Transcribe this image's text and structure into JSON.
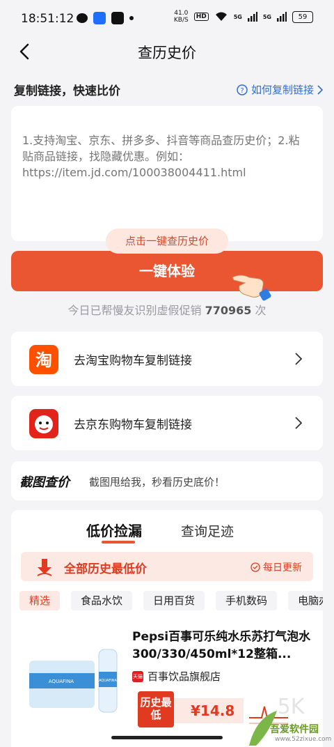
{
  "status_bar": {
    "time": "18:51:12",
    "net_speed": "41.0",
    "net_unit": "KB/S",
    "hd": "HD",
    "battery": "59",
    "signal1": "5G",
    "signal2": "5G"
  },
  "nav": {
    "title": "查历史价"
  },
  "copy_section": {
    "heading": "复制链接，快速比价",
    "howto": "如何复制链接"
  },
  "paste_box": {
    "placeholder": "1.支持淘宝、京东、拼多多、抖音等商品查历史价；2.粘贴商品链接，找隐藏优惠。例如：https://item.jd.com/100038004411.html"
  },
  "cta": {
    "tip": "点击一键查历史价",
    "button": "一键体验"
  },
  "stats": {
    "prefix": "今日已帮慢友识别虚假促销",
    "count": "770965",
    "suffix": "次"
  },
  "links": [
    {
      "icon": "taobao-icon",
      "label": "去淘宝购物车复制链接",
      "color": "#ff5000"
    },
    {
      "icon": "jd-icon",
      "label": "去京东购物车复制链接",
      "color": "#e2231a"
    }
  ],
  "screenshot": {
    "title": "截图查价",
    "desc": "截图甩给我，秒看历史底价！"
  },
  "tabs": {
    "active": "低价捡漏",
    "other": "查询足迹"
  },
  "banner": {
    "title": "全部历史最低价",
    "daily": "每日更新"
  },
  "categories": [
    "精选",
    "食品水饮",
    "日用百货",
    "手机数码",
    "电脑办"
  ],
  "product": {
    "title": "Pepsi百事可乐纯水乐苏打气泡水300/330/450ml*12整箱...",
    "store": "百事饮品旗舰店",
    "store_badge": "天猫",
    "tag": "历史最低",
    "price": "¥14.8",
    "img_label": "AQUAFINA"
  },
  "watermark": {
    "text": "吾爱软件园",
    "sub": "www.52zixue.com"
  },
  "accent": "#ea5532"
}
